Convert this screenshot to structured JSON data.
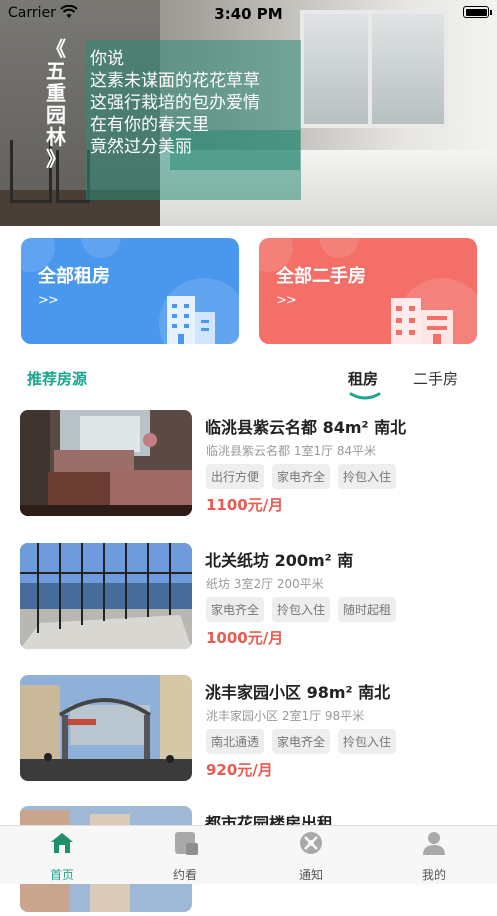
{
  "status_bar": {
    "carrier": "Carrier",
    "time": "3:40 PM"
  },
  "hero": {
    "brand_chars": [
      "《",
      "五",
      "重",
      "园",
      "林",
      "》"
    ],
    "poem": [
      "你说",
      "这素未谋面的花花草草",
      "这强行栽培的包办爱情",
      "在有你的春天里",
      "竟然过分美丽"
    ]
  },
  "cards": {
    "rent": {
      "title": "全部租房",
      "arrows": ">>",
      "color": "#4a97ee"
    },
    "second_hand": {
      "title": "全部二手房",
      "arrows": ">>",
      "color": "#f36f68"
    }
  },
  "section": {
    "title": "推荐房源",
    "tabs": [
      "租房",
      "二手房"
    ],
    "active_tab": "租房",
    "accent": "#1aa58f"
  },
  "listings": [
    {
      "name": "临洮县紫云名都 84m² 南北",
      "sub": "临洮县紫云名都 1室1厅 84平米",
      "tags": [
        "出行方便",
        "家电齐全",
        "拎包入住"
      ],
      "price": "1100元/月"
    },
    {
      "name": "北关纸坊 200m² 南",
      "sub": "纸坊 3室2厅 200平米",
      "tags": [
        "家电齐全",
        "拎包入住",
        "随时起租"
      ],
      "price": "1000元/月"
    },
    {
      "name": " 洮丰家园小区 98m² 南北",
      "sub": "洮丰家园小区 2室1厅 98平米",
      "tags": [
        "南北通透",
        "家电齐全",
        "拎包入住"
      ],
      "price": "920元/月"
    },
    {
      "name": "都市花园楼房出租",
      "sub": "",
      "tags": [],
      "price": ""
    }
  ],
  "tabbar": [
    {
      "label": "首页",
      "icon": "home-icon",
      "active": true
    },
    {
      "label": "约看",
      "icon": "appointment-icon",
      "active": false
    },
    {
      "label": "通知",
      "icon": "notification-icon",
      "active": false
    },
    {
      "label": "我的",
      "icon": "profile-icon",
      "active": false
    }
  ],
  "colors": {
    "price": "#e85a52",
    "accent": "#1aa58f"
  }
}
